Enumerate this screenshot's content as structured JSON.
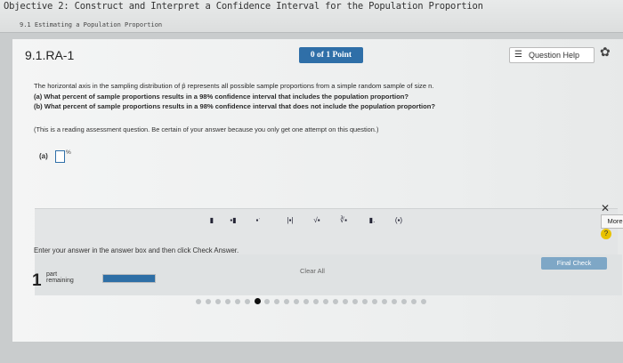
{
  "header": {
    "objective": "Objective 2: Construct and Interpret a Confidence Interval for the Population Proportion",
    "section": "9.1 Estimating a Population Proportion"
  },
  "question": {
    "id": "9.1.RA-1",
    "score": "0 of 1 Point",
    "help_label": "Question Help",
    "text_main": "The horizontal axis in the sampling distribution of p̂ represents all possible sample proportions from a simple random sample of size n.",
    "text_a": "(a) What percent of sample proportions results in a 98% confidence interval that includes the population proportion?",
    "text_b": "(b) What percent of sample proportions results in a 98% confidence interval that does not include the population proportion?",
    "note": "(This is a reading assessment question. Be certain of your answer because you only get one attempt on this question.)",
    "answer_label": "(a)",
    "percent": "%"
  },
  "toolbar": {
    "more_label": "More"
  },
  "footer": {
    "instruction": "Enter your answer in the answer box and then click Check Answer.",
    "count": "1",
    "part": "part",
    "remaining": "remaining",
    "progress": 1.0,
    "clear_label": "Clear All",
    "final_label": "Final Check"
  },
  "dots": {
    "total": 24,
    "active_index": 6
  },
  "colors": {
    "accent": "#2f6fa8",
    "help_yellow": "#e8c200"
  }
}
